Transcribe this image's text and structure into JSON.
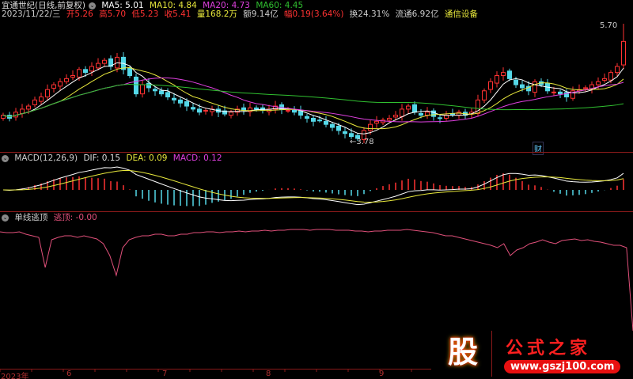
{
  "stock": {
    "name": "宜通世纪(日线,前复权)",
    "ma5": "MA5: 5.01",
    "ma10": "MA10: 4.84",
    "ma20": "MA20: 4.73",
    "ma60": "MA60: 4.45"
  },
  "quote": {
    "date": "2023/11/22/三",
    "open": "开5.26",
    "high": "高5.70",
    "low": "低5.23",
    "close": "收5.41",
    "volume": "量168.2万",
    "amount": "额9.14亿",
    "change": "幅0.19(3.64%)",
    "turnover": "换24.31%",
    "float": "流通6.92亿",
    "sector": "通信设备"
  },
  "labels": {
    "max_price": "5.70",
    "min_price": "←3.78",
    "cai": "财"
  },
  "macd": {
    "title": "MACD(12,26,9)",
    "dif": "DIF: 0.15",
    "dea": "DEA: 0.09",
    "macd": "MACD: 0.12"
  },
  "indicator": {
    "title": "单线逃顶",
    "value": "逃顶: -0.00"
  },
  "xaxis": [
    "2023年",
    "6",
    "7",
    "8",
    "9"
  ],
  "logo": {
    "char": "股",
    "name": "公式之家",
    "url": "www.gszj100.com"
  },
  "colors": {
    "up": "#ff3232",
    "down": "#54d8e8",
    "ma5": "#ffffff",
    "ma10": "#e8e83c",
    "ma20": "#e040e0",
    "ma60": "#30c030",
    "line": "#e0507a"
  },
  "chart_data": {
    "type": "candlestick",
    "price_range": [
      3.78,
      5.7
    ],
    "closes": [
      4.2,
      4.15,
      4.25,
      4.3,
      4.35,
      4.45,
      4.5,
      4.62,
      4.7,
      4.75,
      4.8,
      4.85,
      4.95,
      4.9,
      5.0,
      5.05,
      5.1,
      5.0,
      5.15,
      4.95,
      4.85,
      4.55,
      4.7,
      4.65,
      4.6,
      4.55,
      4.5,
      4.45,
      4.4,
      4.35,
      4.3,
      4.25,
      4.28,
      4.3,
      4.25,
      4.22,
      4.25,
      4.3,
      4.28,
      4.32,
      4.3,
      4.28,
      4.3,
      4.35,
      4.3,
      4.28,
      4.25,
      4.2,
      4.15,
      4.1,
      4.12,
      4.05,
      4.0,
      3.95,
      3.9,
      3.85,
      3.82,
      3.95,
      4.05,
      4.1,
      4.12,
      4.15,
      4.2,
      4.3,
      4.35,
      4.25,
      4.2,
      4.25,
      4.18,
      4.15,
      4.2,
      4.22,
      4.25,
      4.2,
      4.25,
      4.45,
      4.6,
      4.75,
      4.85,
      4.9,
      4.8,
      4.7,
      4.65,
      4.6,
      4.75,
      4.7,
      4.6,
      4.58,
      4.55,
      4.5,
      4.6,
      4.62,
      4.65,
      4.7,
      4.75,
      4.8,
      4.9,
      5.0,
      5.41
    ],
    "escape_top": [
      -5,
      -6,
      -6,
      -5,
      -8,
      -10,
      -12,
      -50,
      -15,
      -12,
      -10,
      -10,
      -12,
      -10,
      -12,
      -14,
      -20,
      -35,
      -60,
      -25,
      -15,
      -12,
      -10,
      -10,
      -8,
      -8,
      -10,
      -10,
      -8,
      -8,
      -6,
      -6,
      -5,
      -5,
      -6,
      -5,
      -5,
      -4,
      -5,
      -4,
      -4,
      -3,
      -4,
      -3,
      -3,
      -2,
      -2,
      -2,
      -3,
      -2,
      -2,
      -2,
      -3,
      -3,
      -3,
      -4,
      -4,
      -5,
      -4,
      -4,
      -3,
      -3,
      -3,
      -2,
      -3,
      -4,
      -5,
      -6,
      -8,
      -10,
      -10,
      -12,
      -14,
      -16,
      -18,
      -20,
      -22,
      -25,
      -20,
      -35,
      -28,
      -25,
      -20,
      -18,
      -15,
      -18,
      -20,
      -16,
      -15,
      -14,
      -16,
      -15,
      -17,
      -18,
      -20,
      -22,
      -22,
      -25,
      -130
    ]
  }
}
